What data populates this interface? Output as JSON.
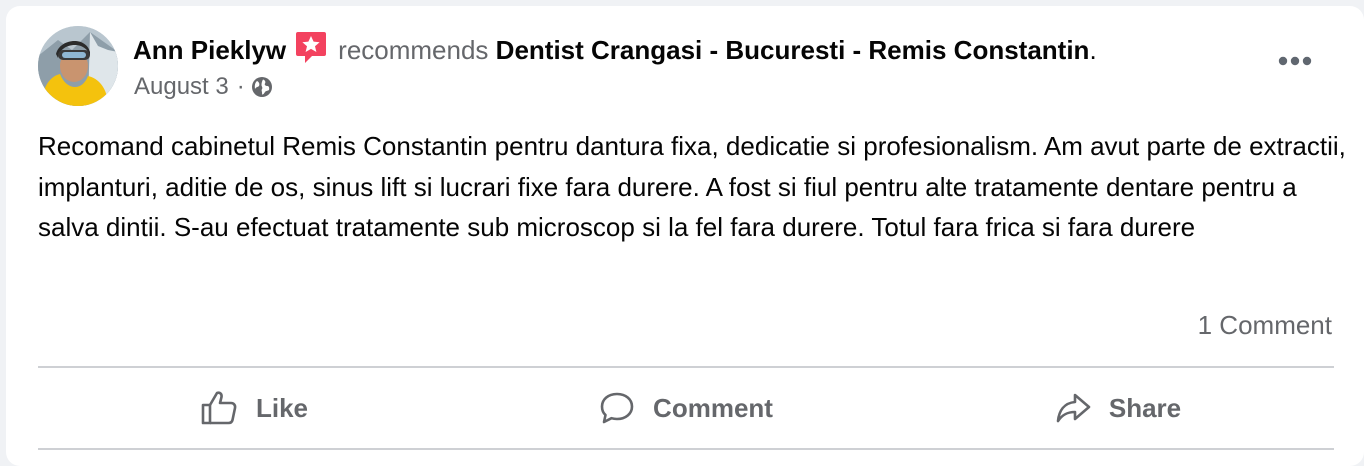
{
  "post": {
    "author": "Ann Pieklyw",
    "action_word": "recommends",
    "page_name": "Dentist Crangasi - Bucuresti - Remis Constantin",
    "page_name_suffix": ".",
    "date": "August 3",
    "separator": "·",
    "audience_icon": "globe-icon",
    "badge_icon": "recommend-star-icon",
    "body": "Recomand cabinetul Remis Constantin pentru dantura fixa, dedicatie si profesionalism. Am avut parte de extractii, implanturi, aditie de os, sinus lift si lucrari fixe fara durere. A fost si fiul pentru alte tratamente dentare pentru a salva dintii. S-au efectuat tratamente sub microscop si la fel fara durere. Totul fara frica si fara durere",
    "comment_count_label": "1 Comment"
  },
  "actions": {
    "like_label": "Like",
    "comment_label": "Comment",
    "share_label": "Share"
  },
  "colors": {
    "badge_pink": "#f3425f",
    "secondary_text": "#65676b",
    "divider": "#ced0d4",
    "page_background": "#f0f2f5"
  }
}
